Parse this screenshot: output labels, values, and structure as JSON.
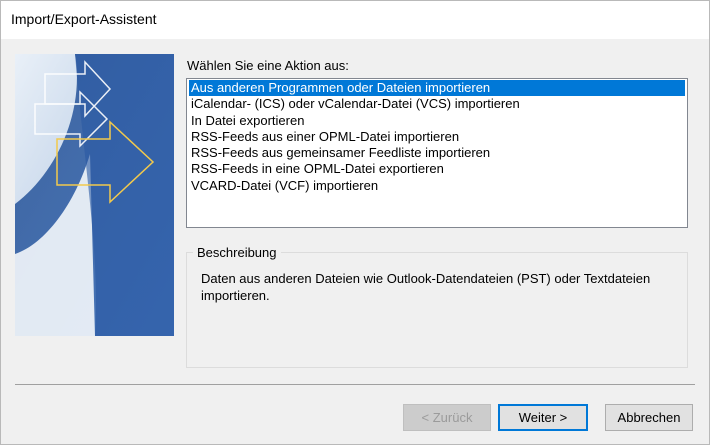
{
  "window": {
    "title": "Import/Export-Assistent"
  },
  "actions": {
    "label": "Wählen Sie eine Aktion aus:",
    "items": [
      "Aus anderen Programmen oder Dateien importieren",
      "iCalendar- (ICS) oder vCalendar-Datei (VCS) importieren",
      "In Datei exportieren",
      "RSS-Feeds aus einer OPML-Datei importieren",
      "RSS-Feeds aus gemeinsamer Feedliste importieren",
      "RSS-Feeds in eine OPML-Datei exportieren",
      "VCARD-Datei (VCF) importieren"
    ],
    "selected_index": 0
  },
  "description": {
    "legend": "Beschreibung",
    "text": "Daten aus anderen Dateien wie Outlook-Datendateien (PST) oder Textdateien importieren."
  },
  "buttons": {
    "back": "< Zurück",
    "next": "Weiter >",
    "cancel": "Abbrechen"
  },
  "colors": {
    "selection": "#0078d7",
    "art_blue": "#2c5aa0",
    "arrow_accent": "#f2c94c"
  }
}
